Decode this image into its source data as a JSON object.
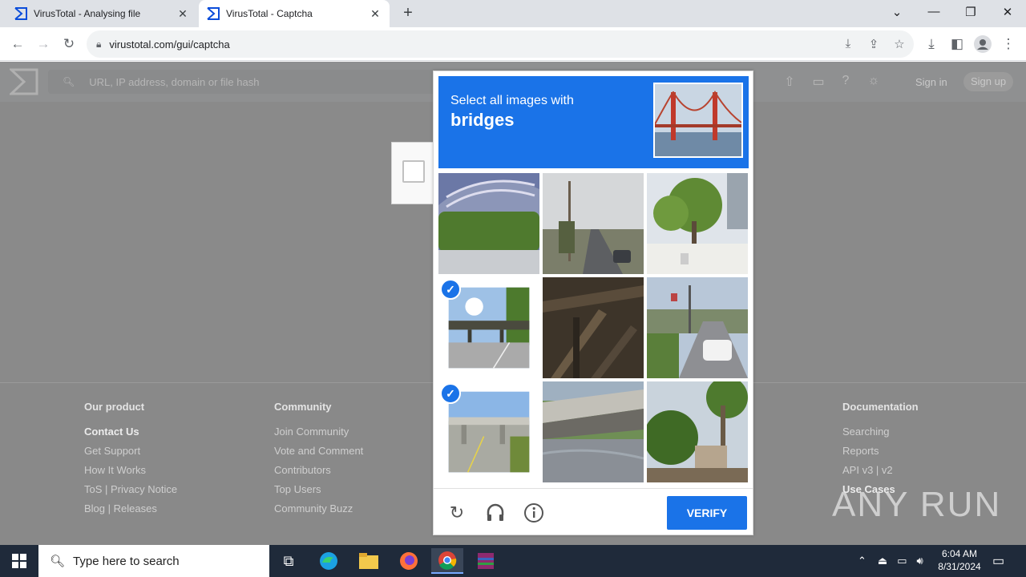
{
  "browser": {
    "tabs": [
      {
        "title": "VirusTotal - Analysing file",
        "active": false
      },
      {
        "title": "VirusTotal - Captcha",
        "active": true
      }
    ],
    "new_tab": "+",
    "url": "virustotal.com/gui/captcha"
  },
  "vt": {
    "search_placeholder": "URL, IP address, domain or file hash",
    "sign_in": "Sign in",
    "sign_up": "Sign up",
    "footer": {
      "product": {
        "heading": "Our product",
        "links": [
          "Contact Us",
          "Get Support",
          "How It Works",
          "ToS | Privacy Notice",
          "Blog | Releases"
        ]
      },
      "community": {
        "heading": "Community",
        "links": [
          "Join Community",
          "Vote and Comment",
          "Contributors",
          "Top Users",
          "Community Buzz"
        ]
      },
      "documentation": {
        "heading": "Documentation",
        "links": [
          "Searching",
          "Reports",
          "API v3 | v2",
          "Use Cases"
        ]
      }
    }
  },
  "captcha": {
    "prompt": "Select all images with",
    "target": "bridges",
    "verify_label": "VERIFY",
    "tiles": [
      {
        "subject": "bush-under-structure",
        "selected": false
      },
      {
        "subject": "street-with-poles",
        "selected": false
      },
      {
        "subject": "trees-and-fence",
        "selected": false
      },
      {
        "subject": "highway-overpass",
        "selected": true
      },
      {
        "subject": "dark-wooden-beams",
        "selected": false
      },
      {
        "subject": "street-with-car",
        "selected": false
      },
      {
        "subject": "highway-overpass",
        "selected": true
      },
      {
        "subject": "concrete-bridge-over-water",
        "selected": false
      },
      {
        "subject": "palm-trees",
        "selected": false
      }
    ]
  },
  "watermark": "ANY RUN",
  "taskbar": {
    "search_placeholder": "Type here to search",
    "time": "6:04 AM",
    "date": "8/31/2024"
  },
  "colors": {
    "accent": "#1a73e8",
    "overlay_gray": "#878787",
    "taskbar": "#1f2a3a"
  }
}
